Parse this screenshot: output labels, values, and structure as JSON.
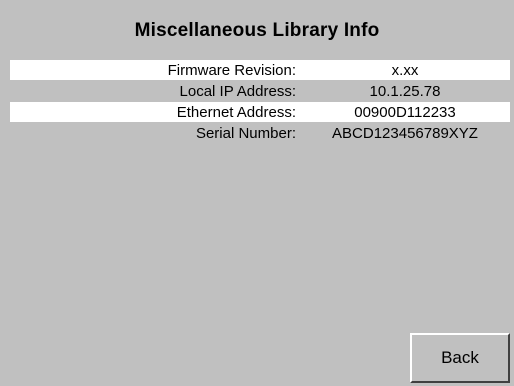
{
  "screen": {
    "title": "Miscellaneous Library Info"
  },
  "info_rows": [
    {
      "label": "Firmware Revision:",
      "value": "x.xx"
    },
    {
      "label": "Local IP Address:",
      "value": "10.1.25.78"
    },
    {
      "label": "Ethernet Address:",
      "value": "00900D112233"
    },
    {
      "label": "Serial Number:",
      "value": "ABCD123456789XYZ"
    }
  ],
  "buttons": {
    "back_label": "Back"
  },
  "colors": {
    "background": "#c0c0c0",
    "highlight_row": "#ffffff"
  }
}
